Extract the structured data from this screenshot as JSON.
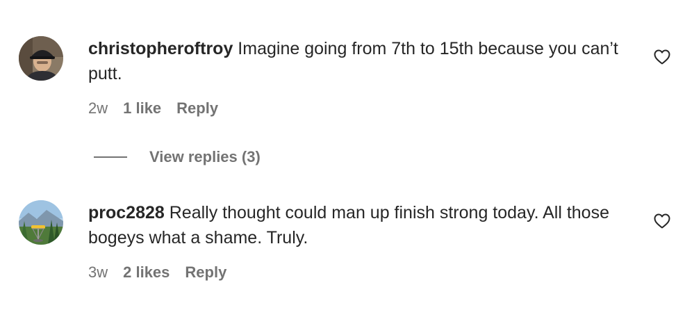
{
  "comments": [
    {
      "username": "christopheroftroy",
      "text": " Imagine going from 7th to 15th because you can’t putt.",
      "time": "2w",
      "likes": "1 like",
      "reply": "Reply",
      "avatar_icon": "user-avatar-cap",
      "like_icon": "heart-outline-icon"
    },
    {
      "username": "proc2828",
      "text": " Really thought could man up finish strong today. All those bogeys what a shame. Truly.",
      "time": "3w",
      "likes": "2 likes",
      "reply": "Reply",
      "avatar_icon": "user-avatar-landscape",
      "like_icon": "heart-outline-icon"
    }
  ],
  "view_replies": {
    "label": "View replies (3)"
  },
  "colors": {
    "text": "#262626",
    "secondary": "#737373",
    "background": "#ffffff"
  }
}
